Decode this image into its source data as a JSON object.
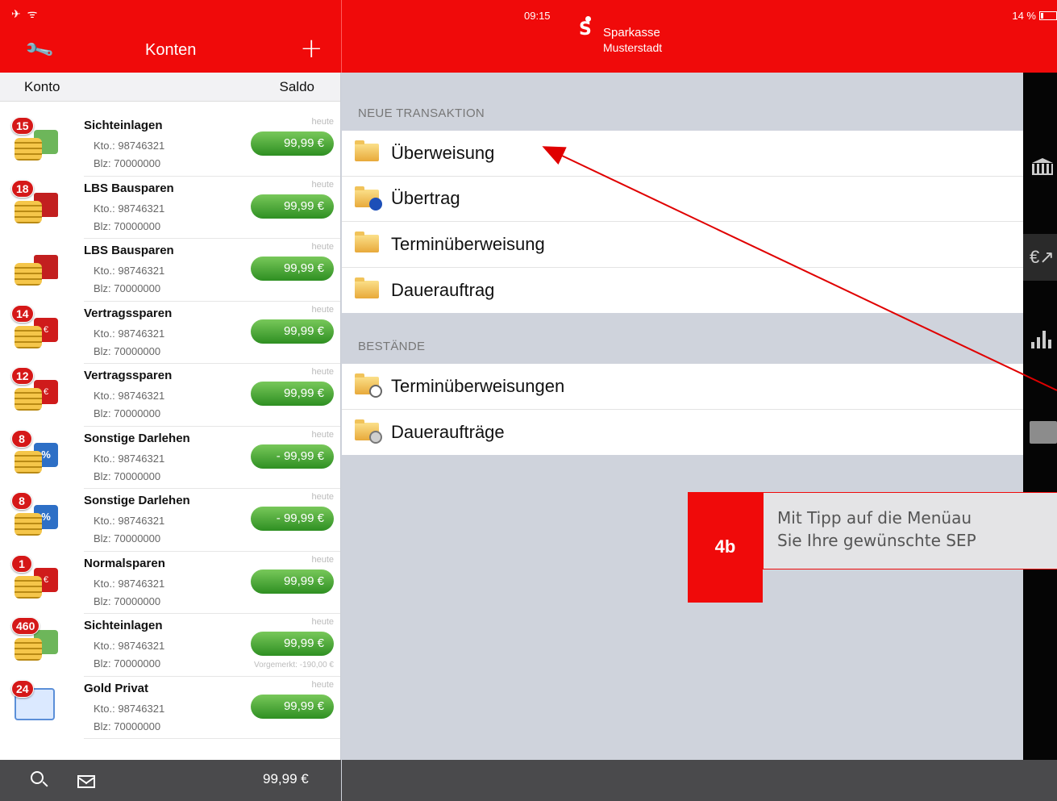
{
  "status": {
    "icons": "✈ ᯤ",
    "time": "09:15",
    "battery": "14 %"
  },
  "brand": {
    "logo_letter": "S",
    "name": "Sparkasse",
    "city": "Musterstadt"
  },
  "left_header": {
    "title": "Konten",
    "plus": "+",
    "wrench": "🔧",
    "col_konto": "Konto",
    "col_saldo": "Saldo"
  },
  "accounts": [
    {
      "name": "Sichteinlagen",
      "kto": "Kto.: 98746321",
      "blz": "Blz: 70000000",
      "date": "heute",
      "amount": "99,99 €",
      "badge": "15",
      "icon": "cash-icon",
      "box_text": ""
    },
    {
      "name": "LBS Bausparen",
      "kto": "Kto.: 98746321",
      "blz": "Blz: 70000000",
      "date": "heute",
      "amount": "99,99 €",
      "badge": "18",
      "icon": "house-icon",
      "box_text": ""
    },
    {
      "name": "LBS Bausparen",
      "kto": "Kto.: 98746321",
      "blz": "Blz: 70000000",
      "date": "heute",
      "amount": "99,99 €",
      "badge": "",
      "icon": "house-icon",
      "box_text": ""
    },
    {
      "name": "Vertragssparen",
      "kto": "Kto.: 98746321",
      "blz": "Blz: 70000000",
      "date": "heute",
      "amount": "99,99 €",
      "badge": "14",
      "icon": "savings-contract-icon",
      "box_text": "€"
    },
    {
      "name": "Vertragssparen",
      "kto": "Kto.: 98746321",
      "blz": "Blz: 70000000",
      "date": "heute",
      "amount": "99,99 €",
      "badge": "12",
      "icon": "savings-contract-icon",
      "box_text": "€"
    },
    {
      "name": "Sonstige Darlehen",
      "kto": "Kto.: 98746321",
      "blz": "Blz: 70000000",
      "date": "heute",
      "amount": "- 99,99 €",
      "badge": "8",
      "icon": "loan-percent-icon",
      "box_text": "%"
    },
    {
      "name": "Sonstige Darlehen",
      "kto": "Kto.: 98746321",
      "blz": "Blz: 70000000",
      "date": "heute",
      "amount": "- 99,99 €",
      "badge": "8",
      "icon": "loan-percent-icon",
      "box_text": "%"
    },
    {
      "name": "Normalsparen",
      "kto": "Kto.: 98746321",
      "blz": "Blz: 70000000",
      "date": "heute",
      "amount": "99,99 €",
      "badge": "1",
      "icon": "savings-icon",
      "box_text": "€"
    },
    {
      "name": "Sichteinlagen",
      "kto": "Kto.: 98746321",
      "blz": "Blz: 70000000",
      "date": "heute",
      "amount": "99,99 €",
      "badge": "460",
      "icon": "cash-icon",
      "box_text": "",
      "note": "Vorgemerkt: -190,00 €"
    },
    {
      "name": "Gold Privat",
      "kto": "Kto.: 98746321",
      "blz": "Blz: 70000000",
      "date": "heute",
      "amount": "99,99 €",
      "badge": "24",
      "icon": "card-icon",
      "box_text": ""
    }
  ],
  "bottom": {
    "total": "99,99 €"
  },
  "sections": {
    "neue_transaktion": "NEUE TRANSAKTION",
    "bestaende": "BESTÄNDE"
  },
  "menu_new": [
    {
      "label": "Überweisung",
      "icon": "transfer-folder-icon"
    },
    {
      "label": "Übertrag",
      "icon": "internal-transfer-folder-icon"
    },
    {
      "label": "Terminüberweisung",
      "icon": "scheduled-transfer-folder-icon"
    },
    {
      "label": "Dauerauftrag",
      "icon": "standing-order-folder-icon"
    }
  ],
  "menu_stock": [
    {
      "label": "Terminüberweisungen",
      "icon": "scheduled-transfers-clock-icon"
    },
    {
      "label": "Daueraufträge",
      "icon": "standing-orders-cycle-icon"
    }
  ],
  "strip": {
    "euro": "€↗"
  },
  "callout": {
    "number": "4b",
    "line1": "Mit Tipp auf die Menüau",
    "line2": "Sie Ihre gewünschte SEP"
  },
  "colors": {
    "brand_red": "#f00a0a",
    "amount_green": "#3a9b2c",
    "panel_bg": "#cfd3dc"
  }
}
